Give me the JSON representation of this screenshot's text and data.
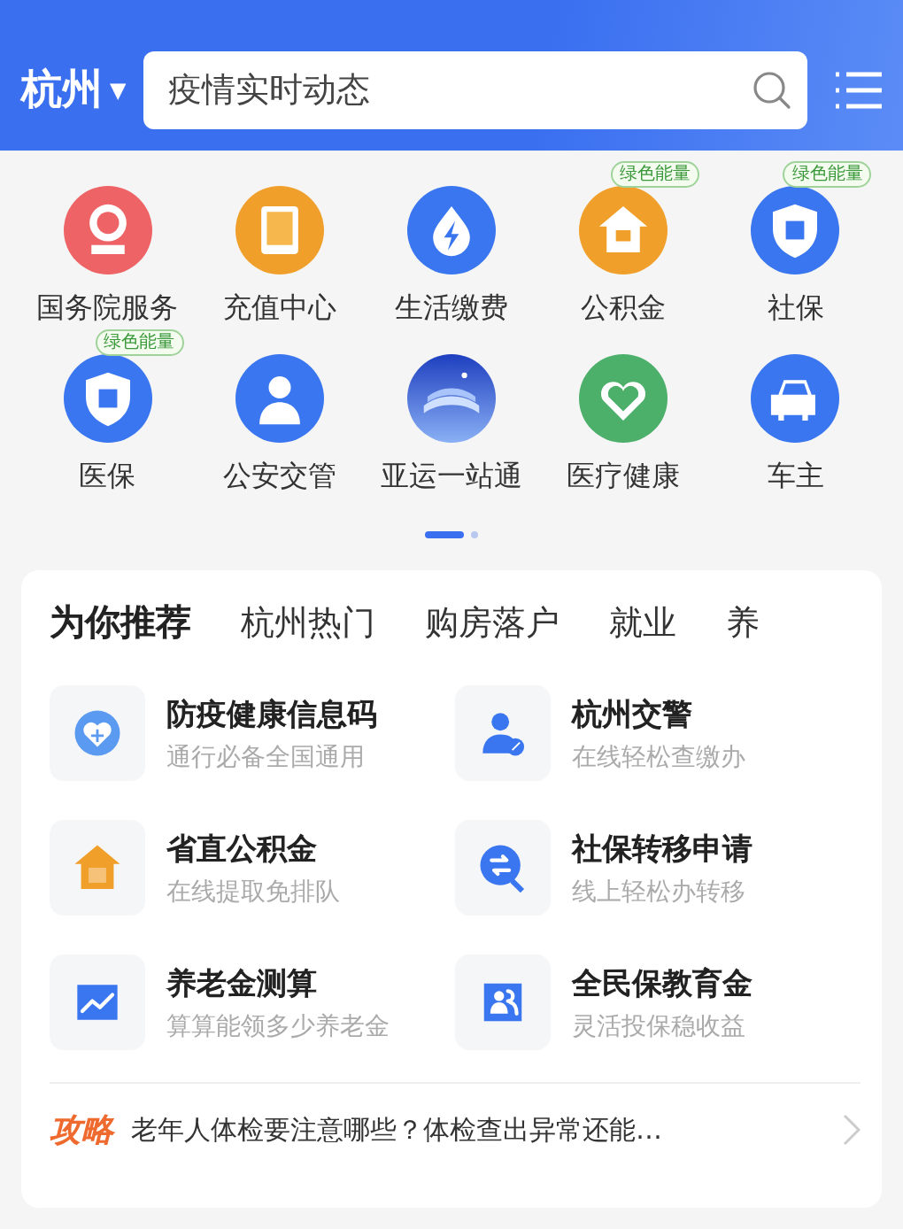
{
  "header": {
    "city": "杭州",
    "city_caret": "▼",
    "search": {
      "placeholder": "疫情实时动态"
    }
  },
  "services": [
    {
      "label": "国务院服务"
    },
    {
      "label": "充值中心"
    },
    {
      "label": "生活缴费"
    },
    {
      "label": "公积金",
      "badge": "绿色能量"
    },
    {
      "label": "社保",
      "badge": "绿色能量"
    },
    {
      "label": "医保",
      "badge": "绿色能量"
    },
    {
      "label": "公安交管"
    },
    {
      "label": "亚运一站通"
    },
    {
      "label": "医疗健康"
    },
    {
      "label": "车主"
    }
  ],
  "pager": [
    {
      "selected": true
    },
    {
      "selected": false
    }
  ],
  "tabs": [
    {
      "label": "为你推荐",
      "selected": true
    },
    {
      "label": "杭州热门",
      "selected": false
    },
    {
      "label": "购房落户",
      "selected": false
    },
    {
      "label": "就业",
      "selected": false
    },
    {
      "label": "养",
      "selected": false
    }
  ],
  "recommendations": [
    {
      "title": "防疫健康信息码",
      "subtitle": "通行必备全国通用"
    },
    {
      "title": "杭州交警",
      "subtitle": "在线轻松查缴办"
    },
    {
      "title": "省直公积金",
      "subtitle": "在线提取免排队"
    },
    {
      "title": "社保转移申请",
      "subtitle": "线上轻松办转移"
    },
    {
      "title": "养老金测算",
      "subtitle": "算算能领多少养老金"
    },
    {
      "title": "全民保教育金",
      "subtitle": "灵活投保稳收益"
    }
  ],
  "guide": {
    "tag": "攻略",
    "text": "老年人体检要注意哪些？体检查出异常还能…"
  }
}
